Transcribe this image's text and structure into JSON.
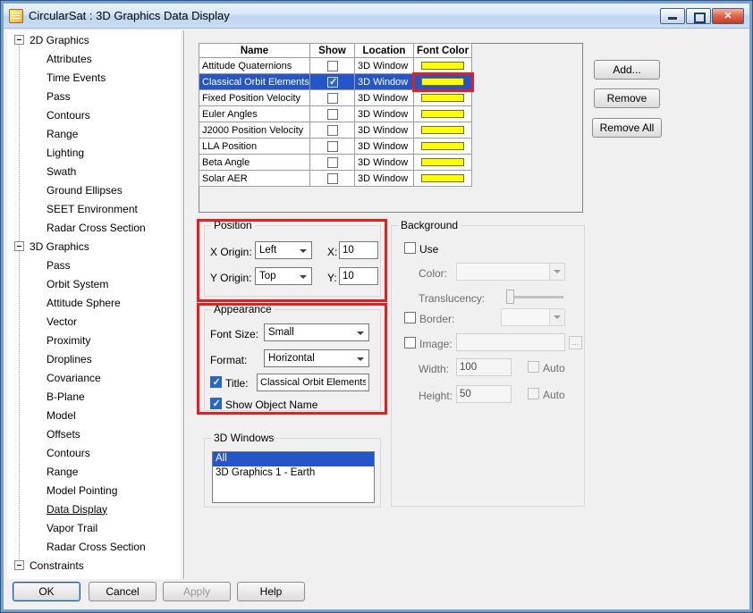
{
  "window": {
    "title": "CircularSat : 3D Graphics Data Display"
  },
  "tree": {
    "sections": [
      {
        "label": "2D Graphics",
        "children": [
          {
            "label": "Attributes"
          },
          {
            "label": "Time Events"
          },
          {
            "label": "Pass"
          },
          {
            "label": "Contours"
          },
          {
            "label": "Range"
          },
          {
            "label": "Lighting"
          },
          {
            "label": "Swath"
          },
          {
            "label": "Ground Ellipses"
          },
          {
            "label": "SEET Environment"
          },
          {
            "label": "Radar Cross Section"
          }
        ]
      },
      {
        "label": "3D Graphics",
        "children": [
          {
            "label": "Pass"
          },
          {
            "label": "Orbit System"
          },
          {
            "label": "Attitude Sphere"
          },
          {
            "label": "Vector"
          },
          {
            "label": "Proximity"
          },
          {
            "label": "Droplines"
          },
          {
            "label": "Covariance"
          },
          {
            "label": "B-Plane"
          },
          {
            "label": "Model"
          },
          {
            "label": "Offsets"
          },
          {
            "label": "Contours"
          },
          {
            "label": "Range"
          },
          {
            "label": "Model Pointing"
          },
          {
            "label": "Data Display",
            "selected": true
          },
          {
            "label": "Vapor Trail"
          },
          {
            "label": "Radar Cross Section"
          }
        ]
      },
      {
        "label": "Constraints",
        "children": []
      }
    ]
  },
  "data_table": {
    "headers": [
      "Name",
      "Show",
      "Location",
      "Font Color"
    ],
    "font_color_hex": "#ffff00",
    "rows": [
      {
        "name": "Attitude Quaternions",
        "show": false,
        "location": "3D Window"
      },
      {
        "name": "Classical Orbit Elements",
        "show": true,
        "location": "3D Window",
        "selected": true,
        "annotated": true
      },
      {
        "name": "Fixed Position Velocity",
        "show": false,
        "location": "3D Window"
      },
      {
        "name": "Euler Angles",
        "show": false,
        "location": "3D Window"
      },
      {
        "name": "J2000 Position Velocity",
        "show": false,
        "location": "3D Window"
      },
      {
        "name": "LLA Position",
        "show": false,
        "location": "3D Window"
      },
      {
        "name": "Beta Angle",
        "show": false,
        "location": "3D Window"
      },
      {
        "name": "Solar AER",
        "show": false,
        "location": "3D Window"
      }
    ]
  },
  "side_buttons": {
    "add": "Add...",
    "remove": "Remove",
    "remove_all": "Remove All"
  },
  "position": {
    "title": "Position",
    "x_origin_label": "X Origin:",
    "x_origin_value": "Left",
    "x_label": "X:",
    "x_value": "10",
    "y_origin_label": "Y Origin:",
    "y_origin_value": "Top",
    "y_label": "Y:",
    "y_value": "10"
  },
  "appearance": {
    "title": "Appearance",
    "font_size_label": "Font Size:",
    "font_size_value": "Small",
    "format_label": "Format:",
    "format_value": "Horizontal",
    "title_label": "Title:",
    "title_value": "Classical Orbit Elements",
    "title_checked": true,
    "show_object_name_label": "Show Object Name",
    "show_object_name_checked": true
  },
  "background": {
    "title": "Background",
    "use_label": "Use",
    "use_checked": false,
    "color_label": "Color:",
    "translucency_label": "Translucency:",
    "border_label": "Border:",
    "border_checked": false,
    "image_label": "Image:",
    "image_checked": false,
    "browse_label": "...",
    "width_label": "Width:",
    "width_value": "100",
    "width_auto_checked": false,
    "height_label": "Height:",
    "height_value": "50",
    "height_auto_checked": false,
    "auto_label": "Auto"
  },
  "windows_3d": {
    "title": "3D Windows",
    "items": [
      {
        "label": "All",
        "selected": true
      },
      {
        "label": "3D Graphics 1 - Earth"
      }
    ]
  },
  "footer": {
    "ok": "OK",
    "cancel": "Cancel",
    "apply": "Apply",
    "help": "Help"
  }
}
